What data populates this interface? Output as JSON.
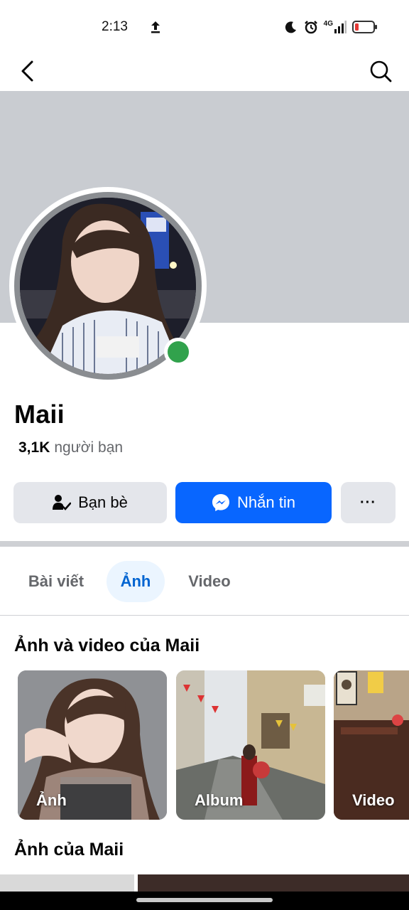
{
  "status_bar": {
    "time": "2:13",
    "network": "4G",
    "icons": [
      "upload-icon",
      "moon-icon",
      "alarm-icon",
      "signal-icon",
      "battery-icon"
    ]
  },
  "nav": {
    "back_icon": "chevron-left-icon",
    "search_icon": "search-icon"
  },
  "profile": {
    "name": "Maii",
    "friends_count": "3,1K",
    "friends_label": "người bạn",
    "online": true
  },
  "actions": {
    "friends_label": "Bạn bè",
    "message_label": "Nhắn tin",
    "more_label": "···"
  },
  "tabs": [
    {
      "label": "Bài viết",
      "active": false
    },
    {
      "label": "Ảnh",
      "active": true
    },
    {
      "label": "Video",
      "active": false
    }
  ],
  "sections": {
    "media_title": "Ảnh và video của Maii",
    "photos_title": "Ảnh của Maii"
  },
  "media_cards": [
    {
      "label": "Ảnh"
    },
    {
      "label": "Album"
    },
    {
      "label": "Video"
    }
  ],
  "colors": {
    "accent": "#0866ff",
    "online": "#31a24c",
    "active_tab_bg": "#ebf5ff",
    "active_tab_text": "#0064d1"
  }
}
